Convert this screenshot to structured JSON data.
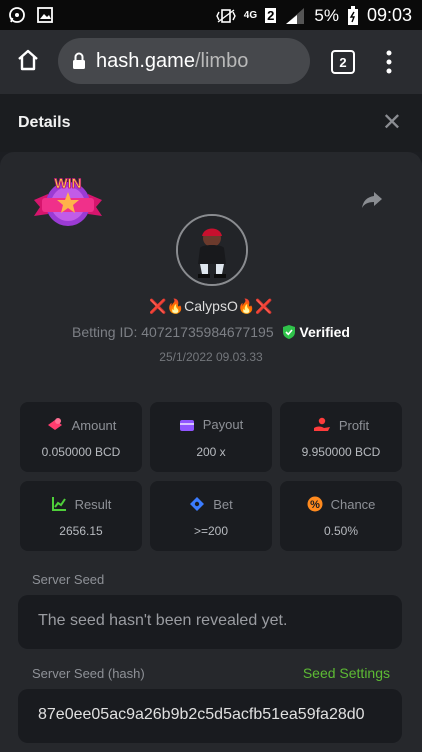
{
  "statusbar": {
    "network": "4G",
    "sim": "2",
    "battery": "5%",
    "time": "09:03"
  },
  "browser": {
    "url_host": "hash.game",
    "url_path": "/limbo",
    "tab_count": "2"
  },
  "details": {
    "title": "Details"
  },
  "player": {
    "name": "❌🔥CalypsO🔥❌",
    "betting_id_label": "Betting ID:",
    "betting_id": "40721735984677195",
    "verified": "Verified",
    "datetime": "25/1/2022 09.03.33",
    "badge": "WIN"
  },
  "stats": [
    {
      "label": "Amount",
      "value": "0.050000 BCD",
      "icon": "coins-icon",
      "color": "#ff3c6e"
    },
    {
      "label": "Payout",
      "value": "200 x",
      "icon": "wallet-icon",
      "color": "#9055ff"
    },
    {
      "label": "Profit",
      "value": "9.950000 BCD",
      "icon": "hand-coin-icon",
      "color": "#ff3c3c"
    },
    {
      "label": "Result",
      "value": "2656.15",
      "icon": "chart-icon",
      "color": "#4fcf3a"
    },
    {
      "label": "Bet",
      "value": ">=200",
      "icon": "ticket-icon",
      "color": "#3b7cff"
    },
    {
      "label": "Chance",
      "value": "0.50%",
      "icon": "percent-icon",
      "color": "#ff8a1e"
    }
  ],
  "server_seed": {
    "label": "Server Seed",
    "value": "The seed hasn't been revealed yet."
  },
  "server_seed_hash": {
    "label": "Server Seed (hash)",
    "settings_link": "Seed Settings",
    "value": "87e0ee05ac9a26b9b2c5d5acfb51ea59fa28d0"
  }
}
